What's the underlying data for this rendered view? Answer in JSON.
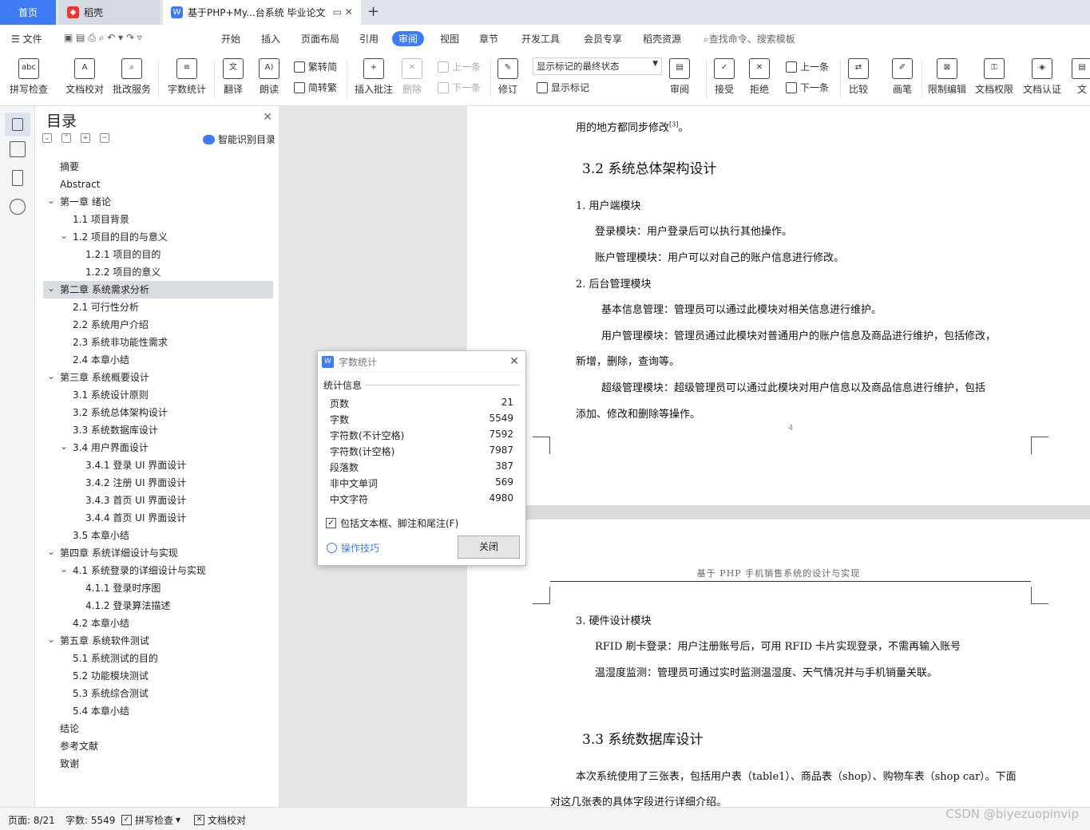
{
  "tabs": {
    "home": "首页",
    "daoke": "稻壳",
    "doc": "基于PHP+My...台系统 毕业论文",
    "plus": "+"
  },
  "menu": {
    "file": "文件",
    "items": [
      "开始",
      "插入",
      "页面布局",
      "引用",
      "审阅",
      "视图",
      "章节",
      "开发工具",
      "会员专享",
      "稻壳资源"
    ],
    "search": "查找命令、搜索模板"
  },
  "ribbon": {
    "spell": "拼写检查",
    "doc_check": "文档校对",
    "batch": "批改服务",
    "wordcount": "字数统计",
    "translate": "翻译",
    "read": "朗读",
    "trad": "繁转简",
    "simp": "简转繁",
    "comment": "插入批注",
    "delete": "删除",
    "prev": "上一条",
    "next": "下一条",
    "revise": "修订",
    "markup_state": "显示标记的最终状态",
    "show_markup": "显示标记",
    "review": "审阅",
    "accept": "接受",
    "reject": "拒绝",
    "prev2": "上一条",
    "next2": "下一条",
    "compare": "比较",
    "pen": "画笔",
    "restrict": "限制编辑",
    "perm": "文档权限",
    "cert": "文档认证",
    "more": "文"
  },
  "toc": {
    "title": "目录",
    "smart": "智能识别目录",
    "items": [
      {
        "text": "摘要",
        "level": 0
      },
      {
        "text": "Abstract",
        "level": 0
      },
      {
        "text": "第一章  绪论",
        "level": 0,
        "car": true
      },
      {
        "text": "1.1  项目背景",
        "level": 1
      },
      {
        "text": "1.2  项目的目的与意义",
        "level": 1,
        "car": true
      },
      {
        "text": "1.2.1  项目的目的",
        "level": 2
      },
      {
        "text": "1.2.2  项目的意义",
        "level": 2
      },
      {
        "text": "第二章  系统需求分析",
        "level": 0,
        "car": true,
        "sel": true
      },
      {
        "text": "2.1  可行性分析",
        "level": 1
      },
      {
        "text": "2.2 系统用户介绍",
        "level": 1
      },
      {
        "text": "2.3  系统非功能性需求",
        "level": 1
      },
      {
        "text": "2.4  本章小结",
        "level": 1
      },
      {
        "text": "第三章  系统概要设计",
        "level": 0,
        "car": true
      },
      {
        "text": "3.1  系统设计原则",
        "level": 1
      },
      {
        "text": "3.2  系统总体架构设计",
        "level": 1
      },
      {
        "text": "3.3  系统数据库设计",
        "level": 1
      },
      {
        "text": "3.4  用户界面设计",
        "level": 1,
        "car": true
      },
      {
        "text": "3.4.1  登录 UI 界面设计",
        "level": 2
      },
      {
        "text": "3.4.2 注册  UI 界面设计",
        "level": 2
      },
      {
        "text": "3.4.3 首页 UI 界面设计",
        "level": 2
      },
      {
        "text": "3.4.4 首页 UI 界面设计",
        "level": 2
      },
      {
        "text": "3.5  本章小结",
        "level": 1
      },
      {
        "text": "第四章  系统详细设计与实现",
        "level": 0,
        "car": true
      },
      {
        "text": "4.1  系统登录的详细设计与实现",
        "level": 1,
        "car": true
      },
      {
        "text": "4.1.1  登录时序图",
        "level": 2
      },
      {
        "text": "4.1.2  登录算法描述",
        "level": 2
      },
      {
        "text": "4.2  本章小结",
        "level": 1
      },
      {
        "text": "第五章  系统软件测试",
        "level": 0,
        "car": true
      },
      {
        "text": "5.1  系统测试的目的",
        "level": 1
      },
      {
        "text": "5.2  功能模块测试",
        "level": 1
      },
      {
        "text": "5.3  系统综合测试",
        "level": 1
      },
      {
        "text": "5.4  本章小结",
        "level": 1
      },
      {
        "text": "结论",
        "level": 0
      },
      {
        "text": "参考文献",
        "level": 0
      },
      {
        "text": "致谢",
        "level": 0
      }
    ]
  },
  "doc": {
    "l1": "用的地方都同步修改",
    "l1ref": "[3]",
    "l1end": "。",
    "h32": "3.2  系统总体架构设计",
    "n1": "1.    用户端模块",
    "p1": "登录模块：用户登录后可以执行其他操作。",
    "p2": "账户管理模块：用户可以对自己的账户信息进行修改。",
    "n2": "2.    后台管理模块",
    "p3": "基本信息管理：管理员可以通过此模块对相关信息进行维护。",
    "p4": "用户管理模块：管理员通过此模块对普通用户的账户信息及商品进行维护，包括修改，",
    "p4b": "新增，删除，查询等。",
    "p5": "超级管理模块：超级管理员可以通过此模块对用户信息以及商品信息进行维护，包括",
    "p5b": "添加、修改和删除等操作。",
    "pagenum": "4",
    "header": "基于 PHP 手机销售系统的设计与实现",
    "n3": "3.    硬件设计模块",
    "p6": "RFID 刷卡登录：用户注册账号后，可用 RFID 卡片实现登录，不需再输入账号",
    "p7": "温湿度监测：管理员可通过实时监测温湿度、天气情况并与手机销量关联。",
    "h33": "3.3  系统数据库设计",
    "p8": "本次系统使用了三张表，包括用户表（table1）、商品表（shop）、购物车表（shop car）。下面",
    "p8b": "对这几张表的具体字段进行详细介绍。"
  },
  "dialog": {
    "title": "字数统计",
    "section": "统计信息",
    "rows": [
      {
        "k": "页数",
        "v": "21"
      },
      {
        "k": "字数",
        "v": "5549"
      },
      {
        "k": "字符数(不计空格)",
        "v": "7592"
      },
      {
        "k": "字符数(计空格)",
        "v": "7987"
      },
      {
        "k": "段落数",
        "v": "387"
      },
      {
        "k": "非中文单词",
        "v": "569"
      },
      {
        "k": "中文字符",
        "v": "4980"
      }
    ],
    "include": "包括文本框、脚注和尾注(F)",
    "tips": "操作技巧",
    "close": "关闭"
  },
  "status": {
    "page": "页面: 8/21",
    "words": "字数: 5549",
    "spell": "拼写检查",
    "check": "文档校对"
  },
  "watermark": "CSDN @biyezuopinvip",
  "colors": {
    "accent": "#3d7cf5"
  }
}
